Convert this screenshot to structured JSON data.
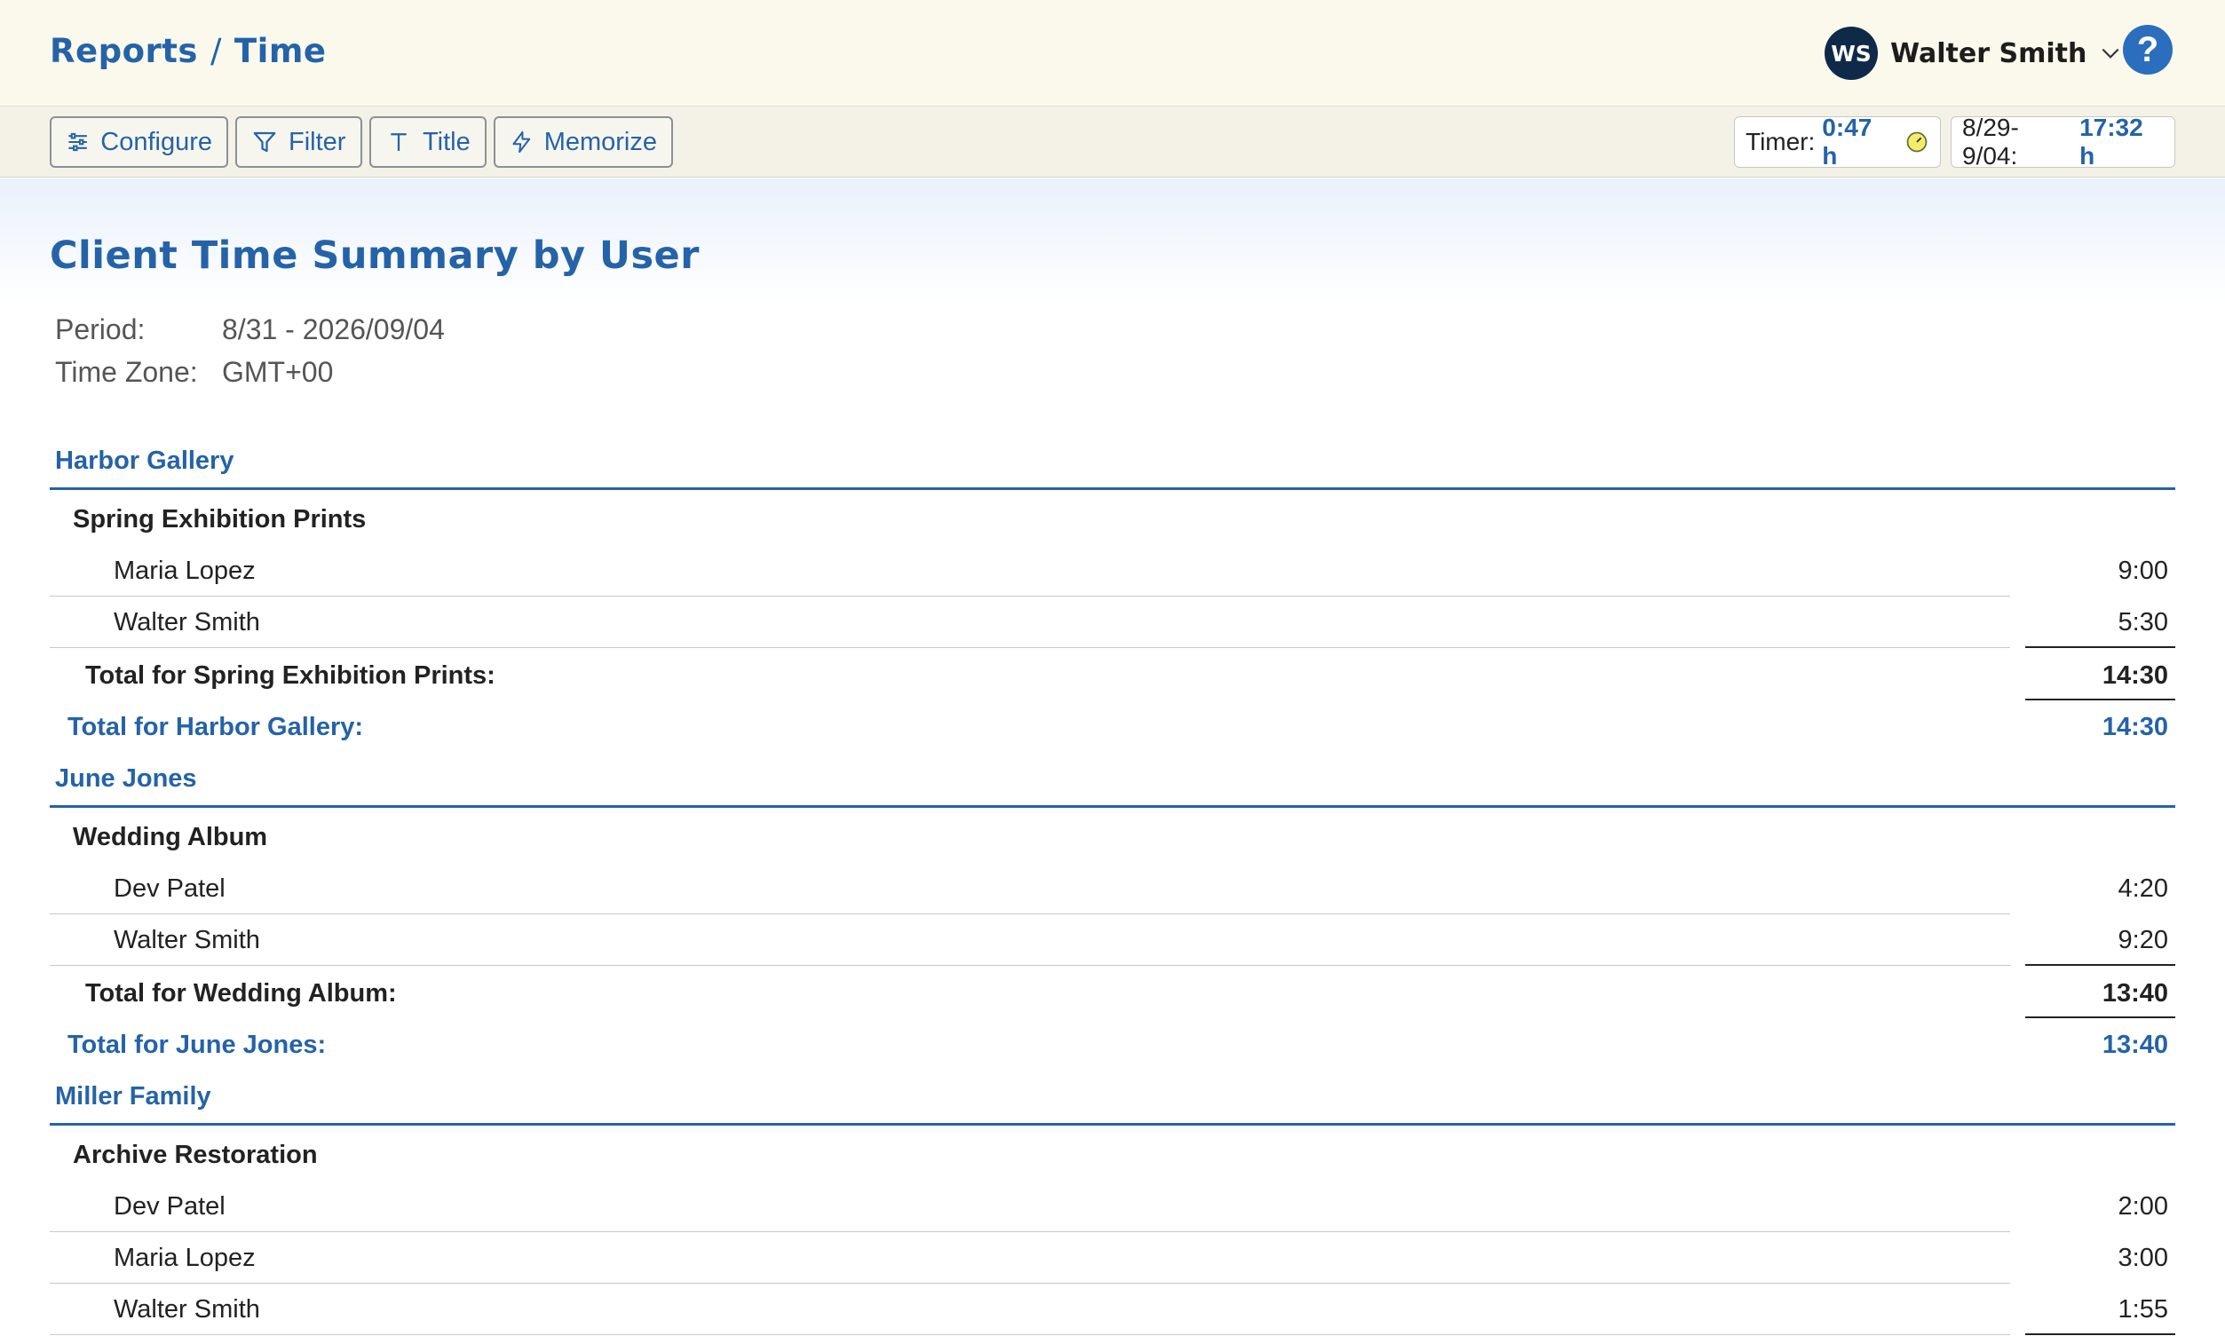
{
  "header": {
    "breadcrumb": [
      "Reports",
      "Time"
    ],
    "breadcrumb_sep": "/",
    "user": {
      "initials": "WS",
      "name": "Walter Smith"
    },
    "help_label": "?"
  },
  "toolbar": {
    "configure_label": "Configure",
    "filter_label": "Filter",
    "title_label": "Title",
    "memorize_label": "Memorize",
    "timer_label": "Timer:",
    "timer_value": "0:47  h",
    "range_label": "8/29-9/04:",
    "range_value": "17:32 h"
  },
  "report": {
    "title": "Client Time Summary by User",
    "period_label": "Period:",
    "period_value": "8/31 - 2026/09/04",
    "tz_label": "Time Zone:",
    "tz_value": "GMT+00",
    "clients": [
      {
        "name": "Harbor Gallery",
        "project": "Spring Exhibition Prints",
        "users": [
          {
            "name": "Maria Lopez",
            "time": "9:00"
          },
          {
            "name": "Walter Smith",
            "time": "5:30"
          }
        ],
        "project_total_label": "Total for Spring Exhibition Prints:",
        "project_total": "14:30",
        "client_total_label": "Total for Harbor Gallery:",
        "client_total": "14:30"
      },
      {
        "name": "June Jones",
        "project": "Wedding Album",
        "users": [
          {
            "name": "Dev Patel",
            "time": "4:20"
          },
          {
            "name": "Walter Smith",
            "time": "9:20"
          }
        ],
        "project_total_label": "Total for Wedding Album:",
        "project_total": "13:40",
        "client_total_label": "Total for June Jones:",
        "client_total": "13:40"
      },
      {
        "name": "Miller Family",
        "project": "Archive Restoration",
        "users": [
          {
            "name": "Dev Patel",
            "time": "2:00"
          },
          {
            "name": "Maria Lopez",
            "time": "3:00"
          },
          {
            "name": "Walter Smith",
            "time": "1:55"
          }
        ]
      }
    ]
  },
  "colors": {
    "accent": "#2563a8",
    "header_bg": "#fbf9ec",
    "avatar_bg": "#0f2a48",
    "help_bg": "#2a6ebd"
  }
}
